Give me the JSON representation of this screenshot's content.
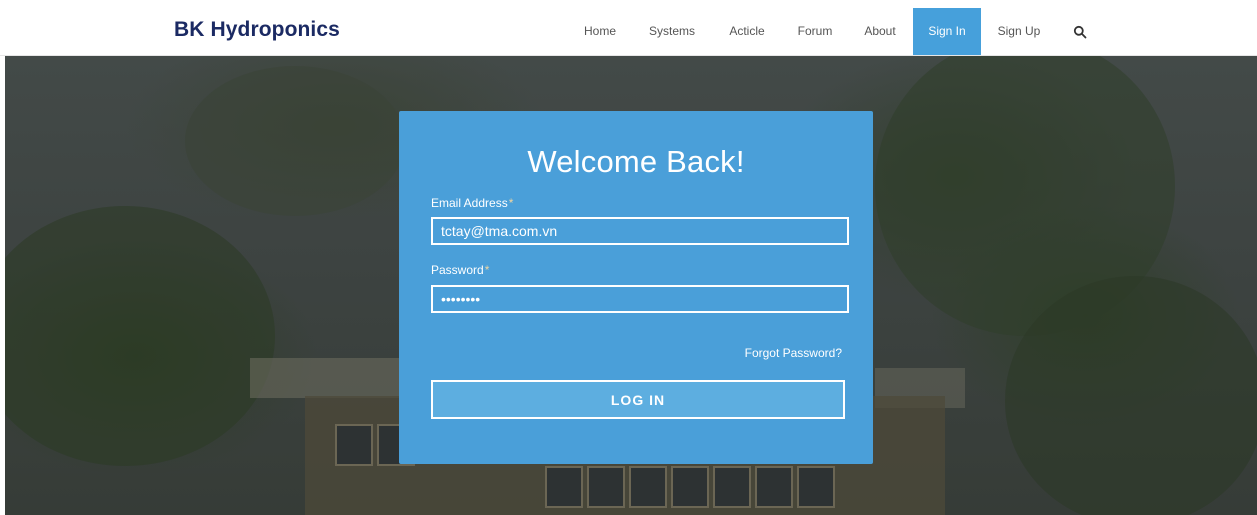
{
  "brand": {
    "name": "BK Hydroponics"
  },
  "nav": {
    "items": [
      {
        "label": "Home",
        "active": false
      },
      {
        "label": "Systems",
        "active": false
      },
      {
        "label": "Acticle",
        "active": false
      },
      {
        "label": "Forum",
        "active": false
      },
      {
        "label": "About",
        "active": false
      },
      {
        "label": "Sign In",
        "active": true
      },
      {
        "label": "Sign Up",
        "active": false
      }
    ],
    "search_icon": "search-icon"
  },
  "login": {
    "title": "Welcome Back!",
    "email_label": "Email Address",
    "email_value": "tctay@tma.com.vn",
    "password_label": "Password",
    "password_value": "tctaytma",
    "required_marker": "*",
    "forgot_link": "Forgot Password?",
    "submit_label": "LOG IN"
  },
  "colors": {
    "accent": "#46a0db",
    "panel": "#4a9fd9",
    "brand_text": "#1b2a63"
  }
}
